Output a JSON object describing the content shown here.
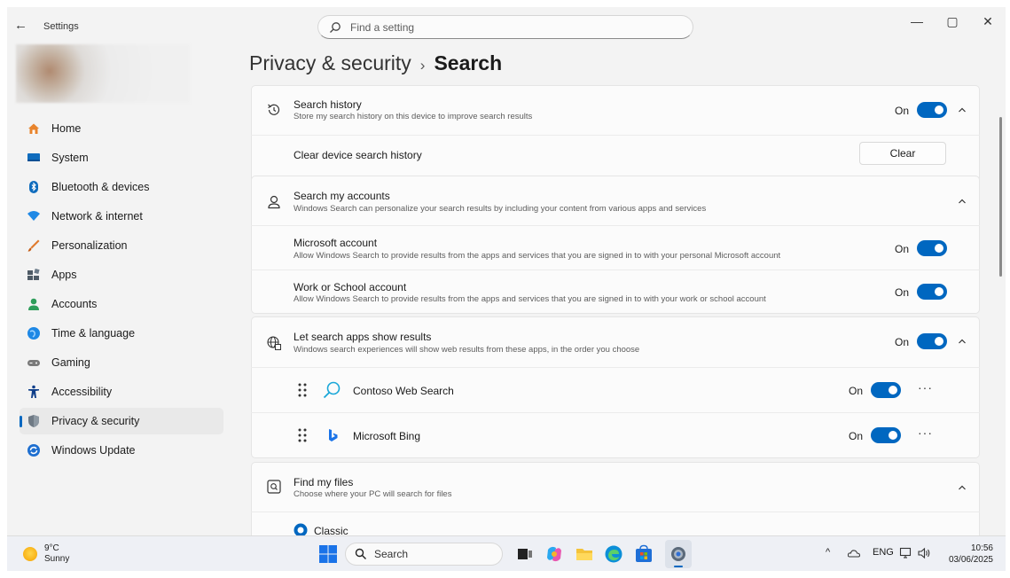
{
  "window": {
    "title": "Settings",
    "search_placeholder": "Find a setting",
    "controls": {
      "minimize": "—",
      "maximize": "▢",
      "close": "✕"
    }
  },
  "sidebar": {
    "items": [
      {
        "label": "Home",
        "icon": "home-icon",
        "color": "#e8842c"
      },
      {
        "label": "System",
        "icon": "system-icon",
        "color": "#0f6cbd"
      },
      {
        "label": "Bluetooth & devices",
        "icon": "bluetooth-icon",
        "color": "#0f6cbd"
      },
      {
        "label": "Network & internet",
        "icon": "network-icon",
        "color": "#1e88e5"
      },
      {
        "label": "Personalization",
        "icon": "brush-icon",
        "color": "#e07a2e"
      },
      {
        "label": "Apps",
        "icon": "apps-icon",
        "color": "#4f5b66"
      },
      {
        "label": "Accounts",
        "icon": "accounts-icon",
        "color": "#2e9d5a"
      },
      {
        "label": "Time & language",
        "icon": "time-language-icon",
        "color": "#1e88e5"
      },
      {
        "label": "Gaming",
        "icon": "gaming-icon",
        "color": "#7a7a7a"
      },
      {
        "label": "Accessibility",
        "icon": "accessibility-icon",
        "color": "#0f3f8a"
      },
      {
        "label": "Privacy & security",
        "icon": "shield-icon",
        "color": "#6f7a85",
        "active": true
      },
      {
        "label": "Windows Update",
        "icon": "update-icon",
        "color": "#1e6fd0"
      }
    ]
  },
  "breadcrumb": {
    "parent": "Privacy & security",
    "separator": "›",
    "current": "Search"
  },
  "sections": {
    "search_history": {
      "title": "Search history",
      "desc": "Store my search history on this device to improve search results",
      "state": "On",
      "clear_title": "Clear device search history",
      "clear_button": "Clear"
    },
    "search_accounts": {
      "title": "Search my accounts",
      "desc": "Windows Search can personalize your search results by including your content from various apps and services",
      "microsoft": {
        "title": "Microsoft account",
        "desc": "Allow Windows Search to provide results from the apps and services that you are signed in to with your personal Microsoft account",
        "state": "On"
      },
      "work": {
        "title": "Work or School account",
        "desc": "Allow Windows Search to provide results from the apps and services that you are signed in to with your work or school account",
        "state": "On"
      }
    },
    "search_apps": {
      "title": "Let search apps show results",
      "desc": "Windows search experiences will show web results from these apps, in the order you choose",
      "state": "On",
      "apps": [
        {
          "name": "Contoso Web Search",
          "state": "On",
          "more": "···"
        },
        {
          "name": "Microsoft Bing",
          "state": "On",
          "more": "···"
        }
      ]
    },
    "find_files": {
      "title": "Find my files",
      "desc": "Choose where your PC will search for files",
      "option": "Classic"
    }
  },
  "taskbar": {
    "weather_temp": "9°C",
    "weather_desc": "Sunny",
    "search_label": "Search",
    "language": "ENG",
    "time": "10:56",
    "date": "03/06/2025"
  },
  "colors": {
    "accent": "#0067c0"
  }
}
